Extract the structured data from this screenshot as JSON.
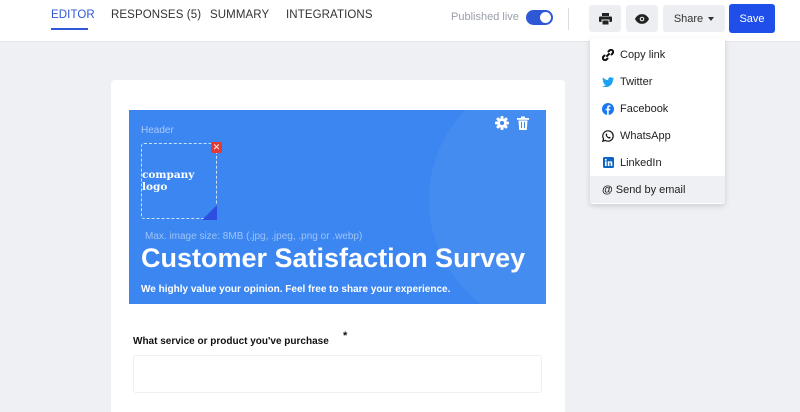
{
  "nav": {
    "tabs": [
      {
        "label": "EDITOR",
        "active": true
      },
      {
        "label": "RESPONSES (5)",
        "active": false
      },
      {
        "label": "SUMMARY",
        "active": false
      },
      {
        "label": "INTEGRATIONS",
        "active": false
      }
    ],
    "published_label": "Published live",
    "published_on": true,
    "print_icon": "print-icon",
    "preview_icon": "eye-icon",
    "share_label": "Share",
    "save_label": "Save"
  },
  "share_menu": {
    "items": [
      {
        "label": "Copy link",
        "icon": "link-icon"
      },
      {
        "label": "Twitter",
        "icon": "twitter-icon"
      },
      {
        "label": "Facebook",
        "icon": "facebook-icon"
      },
      {
        "label": "WhatsApp",
        "icon": "whatsapp-icon"
      },
      {
        "label": "LinkedIn",
        "icon": "linkedin-icon"
      },
      {
        "label": "Send by email",
        "icon": "at-icon"
      }
    ]
  },
  "form": {
    "header_label": "Header",
    "logo_text": "company logo",
    "max_size_text": "Max. image size: 8MB (.jpg, .jpeg, .png or .webp)",
    "title": "Customer Satisfaction Survey",
    "subtitle": "We highly value your opinion. Feel free to share your experience.",
    "question_label": "What service or product you've purchase",
    "required_mark": "*",
    "question_value": ""
  },
  "colors": {
    "accent": "#2f58d6",
    "save": "#1f4ee8",
    "header_bg": "#3b86f1",
    "twitter": "#1da1f2",
    "facebook": "#1877f2",
    "linkedin": "#0a66c2"
  }
}
